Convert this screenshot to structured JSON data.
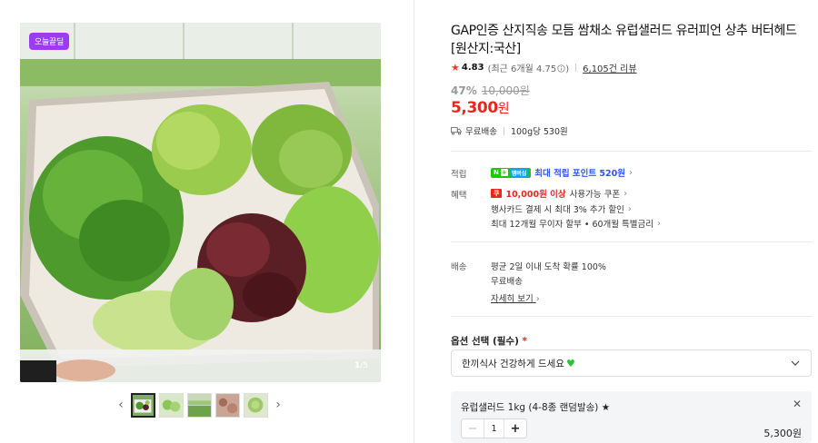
{
  "gallery": {
    "badge": "오늘끝딜",
    "counter_current": "1",
    "counter_total": "/5",
    "prev_arrow": "‹",
    "next_arrow": "›",
    "thumbnail_count": 5
  },
  "product": {
    "title": "GAP인증 산지직송 모듬 쌈채소 유럽샐러드 유러피언 상추 버터헤드 [원산지:국산]",
    "rating": "4.83",
    "recent_rating": "(최근 6개월 4.75",
    "recent_rating_close": ")",
    "review_count": "6,105건 리뷰",
    "discount_rate": "47%",
    "original_price": "10,000원",
    "sale_price": "5,300",
    "sale_currency": "원",
    "shipping": "무료배송",
    "unit_price": "100g당 530원"
  },
  "benefits": {
    "points_label": "적립",
    "npay_n": "N",
    "npay_plus": "+",
    "npay_member": "멤버십",
    "points_text": "최대 적립 포인트 520원",
    "discount_label": "혜택",
    "coupon_badge": "쿠",
    "coupon_amount": "10,000원 이상",
    "coupon_text": "사용가능 쿠폰",
    "card_text": "행사카드 결제 시 최대 3% 추가 할인",
    "installment_text": "최대 12개월 무이자 할부 • 60개월 특별금리"
  },
  "delivery": {
    "label": "배송",
    "eta": "평균 2일 이내 도착 확률 100%",
    "fee": "무료배송",
    "detail_link": "자세히 보기"
  },
  "options": {
    "label": "옵션 선택 (필수)",
    "required_mark": "*",
    "selected_value": "한끼식사 건강하게 드세요",
    "selected_item_name": "유럽샐러드 1kg (4-8종 랜덤발송) ★",
    "quantity": "1",
    "item_price": "5,300원"
  },
  "colors": {
    "accent_red": "#e5271f",
    "badge_purple": "#9c3cf0",
    "npay_green": "#1ec800",
    "point_blue": "#2f54eb"
  },
  "icons": [
    "star-icon",
    "info-circle-icon",
    "truck-icon",
    "chevron-right-icon",
    "chevron-down-icon",
    "close-icon",
    "minus-icon",
    "plus-icon",
    "green-heart-icon"
  ]
}
